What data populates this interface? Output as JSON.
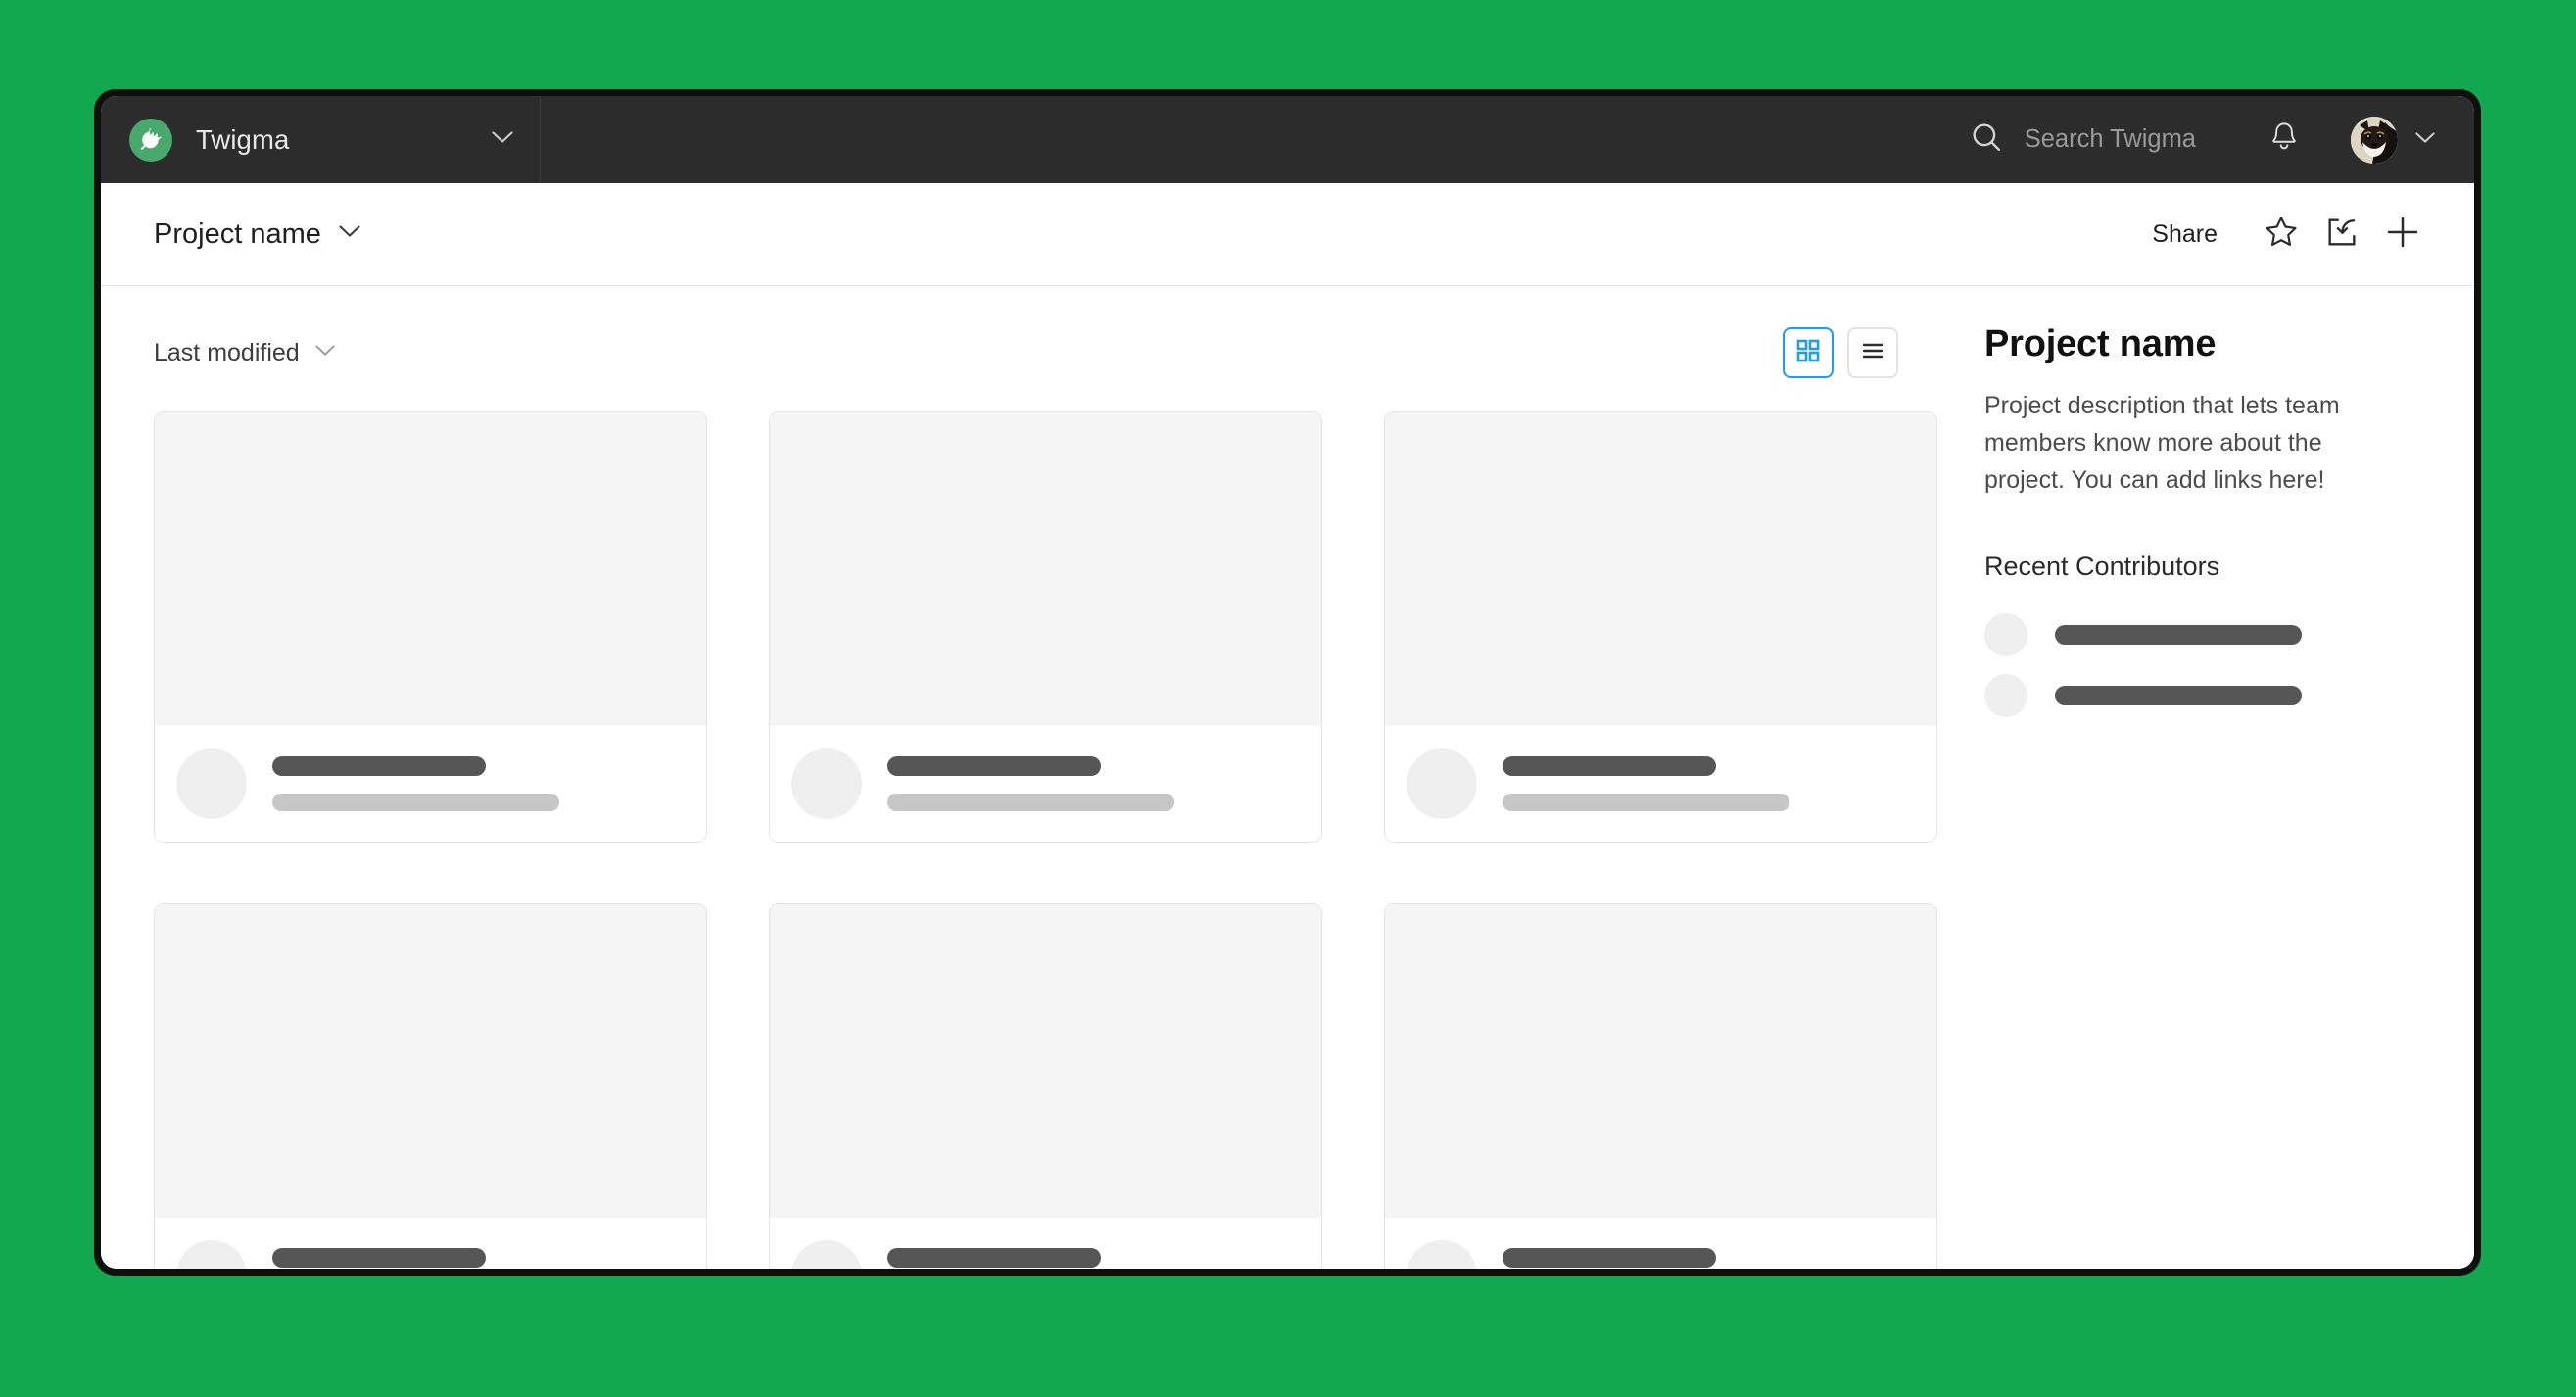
{
  "theme": {
    "page_background": "#12A84F",
    "window_border": "#0f0f0f",
    "topbar_background": "#2c2c2c",
    "accent_blue": "#1E9CF0",
    "logo_green": "#49a86b",
    "placeholder_dark": "#565656",
    "placeholder_light": "#c6c6c6",
    "thumb_gray": "#f5f5f5"
  },
  "topbar": {
    "logo_icon": "leaf-icon",
    "workspace_name": "Twigma",
    "workspace_chevron_icon": "chevron-down-icon",
    "search": {
      "icon": "search-icon",
      "placeholder": "Search Twigma",
      "value": ""
    },
    "notifications_icon": "bell-icon",
    "avatar_icon": "user-avatar-dog",
    "avatar_chevron_icon": "chevron-down-icon"
  },
  "subbar": {
    "breadcrumb_label": "Project name",
    "breadcrumb_chevron_icon": "chevron-down-icon",
    "share_label": "Share",
    "favorite_icon": "star-icon",
    "import_icon": "import-icon",
    "new_icon": "plus-icon"
  },
  "content": {
    "sort": {
      "label": "Last modified",
      "chevron_icon": "chevron-down-icon"
    },
    "views": [
      {
        "name": "grid-view",
        "icon": "grid-icon",
        "active": true
      },
      {
        "name": "list-view",
        "icon": "list-icon",
        "active": false
      }
    ],
    "cards": [
      {
        "avatar_icon": "file-avatar",
        "title_placeholder": true,
        "subtitle_placeholder": true,
        "title_width": "52%",
        "subtitle_width": "70%"
      },
      {
        "avatar_icon": "file-avatar",
        "title_placeholder": true,
        "subtitle_placeholder": true,
        "title_width": "52%",
        "subtitle_width": "70%"
      },
      {
        "avatar_icon": "file-avatar",
        "title_placeholder": true,
        "subtitle_placeholder": true,
        "title_width": "52%",
        "subtitle_width": "70%"
      },
      {
        "avatar_icon": "file-avatar",
        "title_placeholder": true,
        "subtitle_placeholder": true,
        "title_width": "52%",
        "subtitle_width": "70%"
      },
      {
        "avatar_icon": "file-avatar",
        "title_placeholder": true,
        "subtitle_placeholder": true,
        "title_width": "52%",
        "subtitle_width": "70%"
      },
      {
        "avatar_icon": "file-avatar",
        "title_placeholder": true,
        "subtitle_placeholder": true,
        "title_width": "52%",
        "subtitle_width": "70%"
      }
    ]
  },
  "sidebar": {
    "title": "Project name",
    "description": "Project description that lets team members know more about the project. You can add links here!",
    "contributors_heading": "Recent Contributors",
    "contributors": [
      {
        "avatar_icon": "contributor-avatar",
        "name_placeholder": true
      },
      {
        "avatar_icon": "contributor-avatar",
        "name_placeholder": true
      }
    ]
  }
}
